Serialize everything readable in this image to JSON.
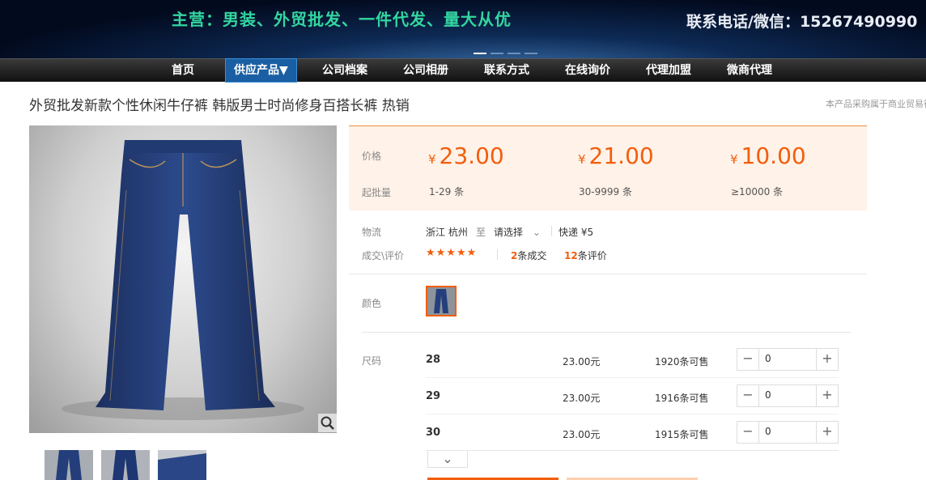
{
  "banner": {
    "slogan": "主营：男装、外贸批发、一件代发、量大从优",
    "phone": "联系电话/微信：15267490990"
  },
  "nav": {
    "items": [
      "首页",
      "供应产品▼",
      "公司档案",
      "公司相册",
      "联系方式",
      "在线询价",
      "代理加盟",
      "微商代理"
    ],
    "active_index": 1
  },
  "product": {
    "title": "外贸批发新款个性休闲牛仔裤 韩版男士时尚修身百搭长裤 热销",
    "note": "本产品采购属于商业贸易行为"
  },
  "pricing": {
    "price_label": "价格",
    "moq_label": "起批量",
    "currency": "¥",
    "tiers": [
      {
        "price": "23.00",
        "qty": "1-29",
        "unit": "条"
      },
      {
        "price": "21.00",
        "qty": "30-9999",
        "unit": "条"
      },
      {
        "price": "10.00",
        "qty": "≥10000",
        "unit": "条"
      }
    ]
  },
  "logistics": {
    "label": "物流",
    "from": "浙江 杭州",
    "to_word": "至",
    "select": "请选择",
    "shipping": "快递 ¥5"
  },
  "deals": {
    "label": "成交\\评价",
    "stars": "★★★★★",
    "rating": 4.5,
    "deal_count": "2",
    "deal_text": "条成交",
    "review_count": "12",
    "review_text": "条评价"
  },
  "color": {
    "label": "颜色"
  },
  "sizes": {
    "label": "尺码",
    "rows": [
      {
        "size": "28",
        "price": "23.00元",
        "stock": "1920条可售",
        "qty": "0"
      },
      {
        "size": "29",
        "price": "23.00元",
        "stock": "1916条可售",
        "qty": "0"
      },
      {
        "size": "30",
        "price": "23.00元",
        "stock": "1915条可售",
        "qty": "0"
      }
    ],
    "minus": "−",
    "plus": "+",
    "expand": "⌄"
  },
  "colors": {
    "accent": "#f25e0d",
    "price_bg": "#fff2e8",
    "nav_active": "#1a5fa3",
    "slogan": "#33d6a0"
  }
}
